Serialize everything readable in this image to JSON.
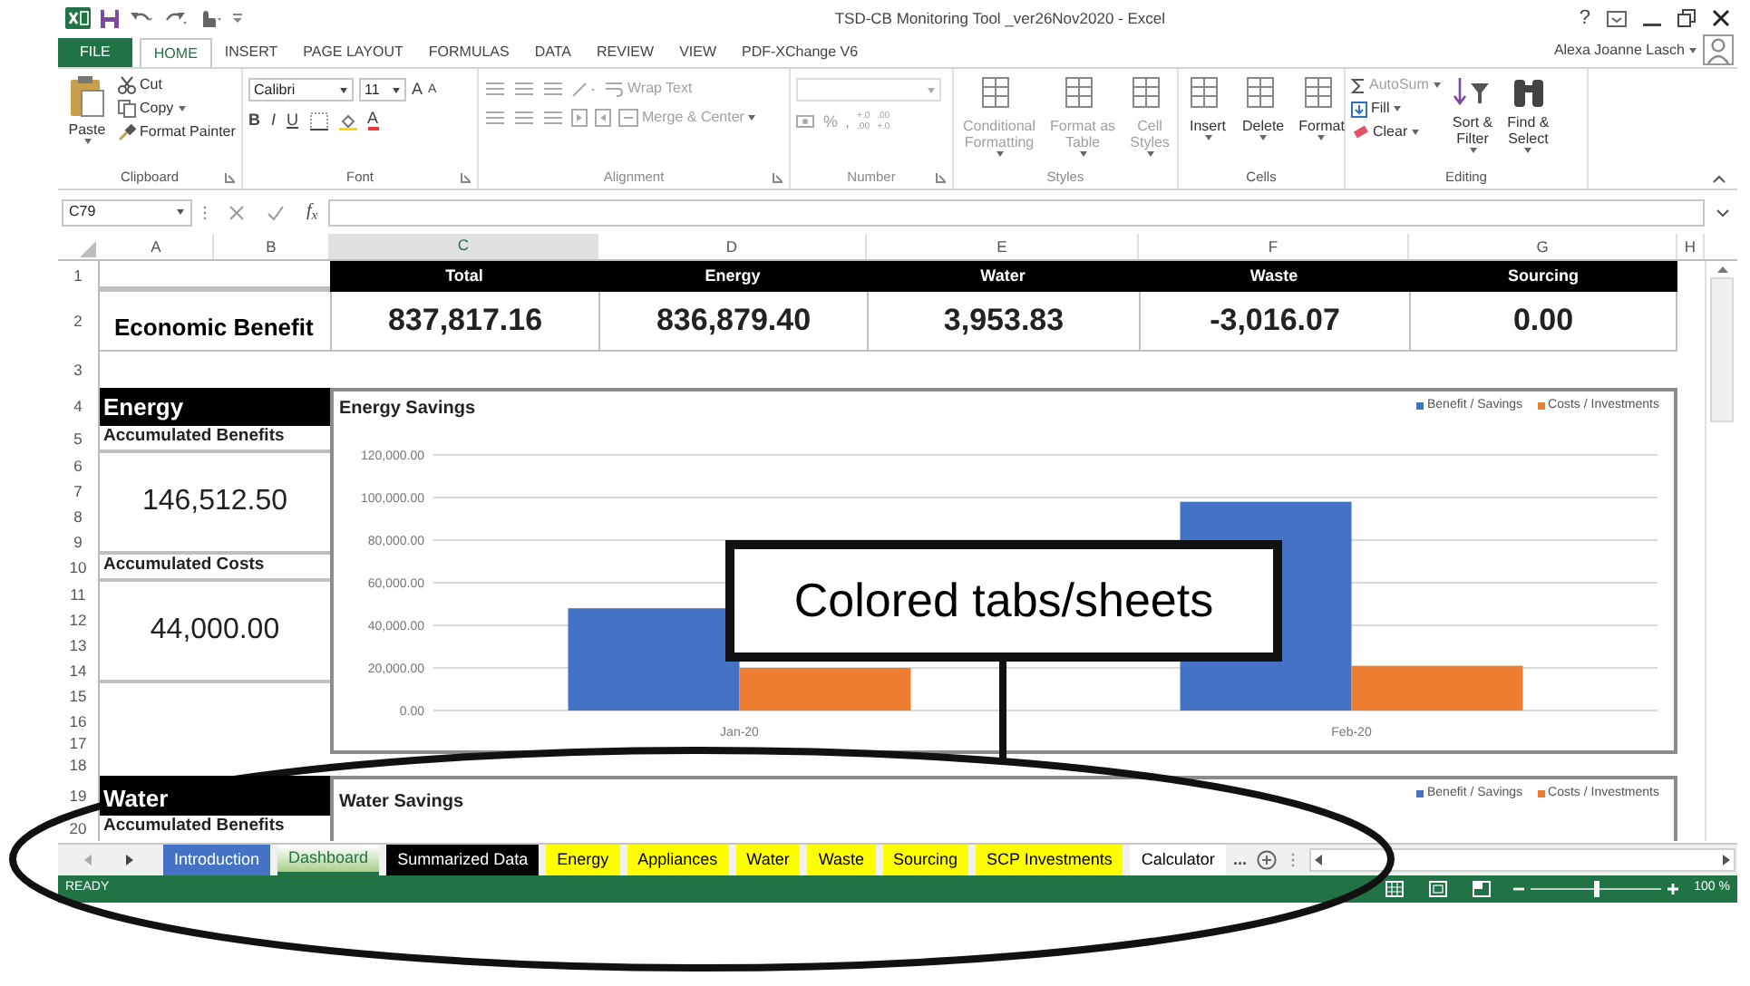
{
  "title_bar": {
    "title": "TSD-CB Monitoring Tool _ver26Nov2020 - Excel",
    "help": "?",
    "user": "Alexa Joanne Lasch"
  },
  "ribbon_tabs": [
    {
      "label": "FILE",
      "kind": "file",
      "selected": false
    },
    {
      "label": "HOME",
      "kind": "tab",
      "selected": true
    },
    {
      "label": "INSERT",
      "kind": "tab",
      "selected": false
    },
    {
      "label": "PAGE LAYOUT",
      "kind": "tab",
      "selected": false
    },
    {
      "label": "FORMULAS",
      "kind": "tab",
      "selected": false
    },
    {
      "label": "DATA",
      "kind": "tab",
      "selected": false
    },
    {
      "label": "REVIEW",
      "kind": "tab",
      "selected": false
    },
    {
      "label": "VIEW",
      "kind": "tab",
      "selected": false
    },
    {
      "label": "PDF-XChange V6",
      "kind": "tab",
      "selected": false
    }
  ],
  "ribbon_groups": [
    {
      "label": "Clipboard",
      "kind": "clipboard",
      "disabled": false,
      "items": [
        {
          "lines": [
            "Paste"
          ],
          "dropdown": true
        },
        {
          "lines": [
            "Cut"
          ],
          "dropdown": false
        },
        {
          "lines": [
            "Copy"
          ],
          "dropdown": true
        },
        {
          "lines": [
            "Format Painter"
          ],
          "dropdown": false
        }
      ]
    },
    {
      "label": "Font",
      "kind": "font",
      "disabled": false,
      "font_name": "Calibri",
      "font_size": "11",
      "grow": "A",
      "shrink": "A",
      "styles": [
        "B",
        "I",
        "U"
      ],
      "font_color": "A"
    },
    {
      "label": "Alignment",
      "kind": "alignment",
      "disabled": true,
      "items": [
        {
          "lines": [
            "Wrap Text"
          ],
          "dropdown": false
        },
        {
          "lines": [
            "Merge & Center"
          ],
          "dropdown": true
        }
      ]
    },
    {
      "label": "Number",
      "kind": "number",
      "disabled": true,
      "percent": "%",
      "comma": ",",
      "decimals": [
        {
          "top": "+.0",
          "bottom": ".00"
        },
        {
          "top": ".00",
          "bottom": "+.0"
        }
      ]
    },
    {
      "label": "Styles",
      "kind": "large",
      "disabled": true,
      "items": [
        {
          "lines": [
            "Conditional",
            "Formatting"
          ],
          "dropdown": true
        },
        {
          "lines": [
            "Format as",
            "Table"
          ],
          "dropdown": true
        },
        {
          "lines": [
            "Cell",
            "Styles"
          ],
          "dropdown": true
        }
      ]
    },
    {
      "label": "Cells",
      "kind": "large",
      "disabled": false,
      "items": [
        {
          "lines": [
            "Insert"
          ],
          "dropdown": true
        },
        {
          "lines": [
            "Delete"
          ],
          "dropdown": true
        },
        {
          "lines": [
            "Format"
          ],
          "dropdown": true
        }
      ]
    },
    {
      "label": "Editing",
      "kind": "editing",
      "disabled": false,
      "items": [
        {
          "lines": [
            "AutoSum"
          ],
          "dropdown": true
        },
        {
          "lines": [
            "Fill"
          ],
          "dropdown": true
        },
        {
          "lines": [
            "Clear"
          ],
          "dropdown": true
        },
        {
          "lines": [
            "Sort &",
            "Filter"
          ],
          "dropdown": true
        },
        {
          "lines": [
            "Find &",
            "Select"
          ],
          "dropdown": true
        }
      ]
    }
  ],
  "formula_bar": {
    "name_box": "C79",
    "function": "f$_{x}$"
  },
  "columns": [
    {
      "label": "A",
      "selected": false
    },
    {
      "label": "B",
      "selected": false
    },
    {
      "label": "C",
      "selected": true
    },
    {
      "label": "D",
      "selected": false
    },
    {
      "label": "E",
      "selected": false
    },
    {
      "label": "F",
      "selected": false
    },
    {
      "label": "G",
      "selected": false
    },
    {
      "label": "H",
      "selected": false
    }
  ],
  "rows": [
    "1",
    "2",
    "3",
    "4",
    "5",
    "6",
    "7",
    "8",
    "9",
    "10",
    "11",
    "12",
    "13",
    "14",
    "15",
    "16",
    "17",
    "18",
    "19",
    "20"
  ],
  "summary": {
    "label": "Economic Benefit",
    "cells": [
      {
        "header": "Total",
        "value": "837,817.16"
      },
      {
        "header": "Energy",
        "value": "836,879.40"
      },
      {
        "header": "Water",
        "value": "3,953.83"
      },
      {
        "header": "Waste",
        "value": "-3,016.07"
      },
      {
        "header": "Sourcing",
        "value": "0.00"
      }
    ]
  },
  "energy": {
    "title": "Energy",
    "benefits_label": "Accumulated Benefits",
    "benefits_value": "146,512.50",
    "costs_label": "Accumulated Costs",
    "costs_value": "44,000.00",
    "chart_data": {
      "type": "bar",
      "title": "Energy Savings",
      "legend": "top-right",
      "grid": true,
      "categories": [
        "Jan-20",
        "Feb-20"
      ],
      "series": [
        {
          "name": "Benefit / Savings",
          "color": "#4472c4",
          "values": [
            48000,
            98000
          ]
        },
        {
          "name": "Costs / Investments",
          "color": "#ed7d31",
          "values": [
            20000,
            21000
          ]
        }
      ],
      "ylim": [
        0,
        120000
      ],
      "yticks": [
        {
          "value": 0,
          "label": "0.00"
        },
        {
          "value": 20000,
          "label": "20,000.00"
        },
        {
          "value": 40000,
          "label": "40,000.00"
        },
        {
          "value": 60000,
          "label": "60,000.00"
        },
        {
          "value": 80000,
          "label": "80,000.00"
        },
        {
          "value": 100000,
          "label": "100,000.00"
        },
        {
          "value": 120000,
          "label": "120,000.00"
        }
      ]
    }
  },
  "water": {
    "title": "Water",
    "benefits_label": "Accumulated Benefits",
    "chart": {
      "title": "Water Savings",
      "legend": [
        {
          "label": "Benefit / Savings",
          "color": "#4472c4"
        },
        {
          "label": "Costs / Investments",
          "color": "#ed7d31"
        }
      ]
    }
  },
  "sheet_tabs": [
    {
      "label": "Introduction",
      "color": "#4472c4",
      "selected": false
    },
    {
      "label": "Dashboard",
      "color": "#a9d08e",
      "selected": true
    },
    {
      "label": "Summarized Data",
      "color": "#000000",
      "selected": false
    },
    {
      "label": "Energy",
      "color": "#ffff00",
      "selected": false
    },
    {
      "label": "Appliances",
      "color": "#ffff00",
      "selected": false
    },
    {
      "label": "Water",
      "color": "#ffff00",
      "selected": false
    },
    {
      "label": "Waste",
      "color": "#ffff00",
      "selected": false
    },
    {
      "label": "Sourcing",
      "color": "#ffff00",
      "selected": false
    },
    {
      "label": "SCP Investments",
      "color": "#ffff00",
      "selected": false
    },
    {
      "label": "Calculator",
      "selected": false
    }
  ],
  "more_sheets": "...",
  "status_bar": {
    "mode": "READY",
    "zoom": {
      "level": 0.5,
      "reading": "100 %"
    }
  },
  "annotation": {
    "callout": "Colored tabs/sheets"
  }
}
